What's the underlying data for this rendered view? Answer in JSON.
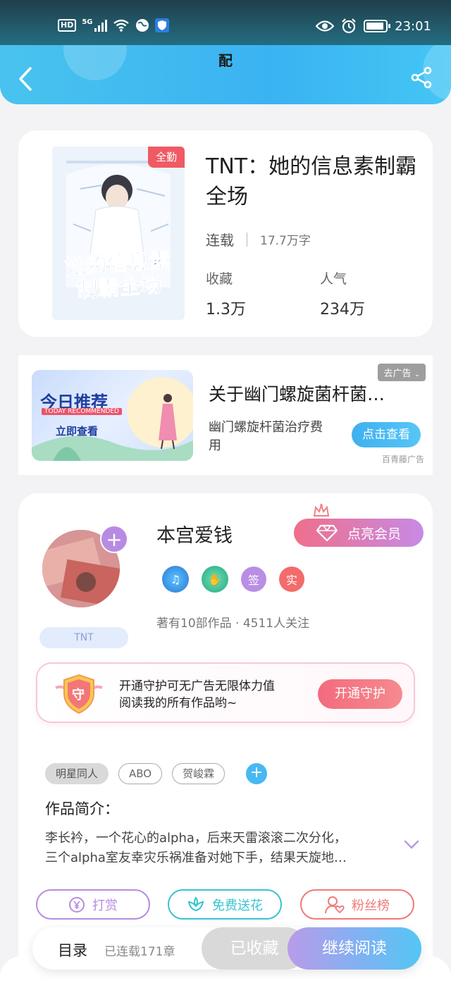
{
  "status_bar": {
    "hd": "HD",
    "network": "5G",
    "time": "23:01"
  },
  "header": {
    "title": "配"
  },
  "book": {
    "cover_badge": "全勤",
    "cover_title_text": "她的信息素 制霸全场",
    "title": "TNT：她的信息素制霸全场",
    "status": "连载",
    "words": "17.7万字",
    "favorites_label": "收藏",
    "favorites_value": "1.3万",
    "popularity_label": "人气",
    "popularity_value": "234万"
  },
  "ad": {
    "image_title": "今日推荐",
    "image_subtitle": "TODAY RECOMMENDED",
    "image_cta": "立即查看",
    "hide_label": "去广告",
    "title": "关于幽门螺旋菌杆菌…",
    "description": "幽门螺旋杆菌治疗费用",
    "button": "点击查看",
    "source": "百青藤广告"
  },
  "author": {
    "name": "本宫爱钱",
    "vip_button": "点亮会员",
    "tag": "TNT",
    "badge_sign": "签",
    "badge_real": "实",
    "meta": "著有10部作品 · 4511人关注",
    "guard_icon_text": "守",
    "guard_text_line1": "开通守护可无广告无限体力值",
    "guard_text_line2": "阅读我的所有作品哟~",
    "guard_button": "开通守护"
  },
  "tags": [
    "明星同人",
    "ABO",
    "贺峻霖"
  ],
  "intro": {
    "title": "作品简介：",
    "line1": "李长衿，一个花心的alpha，后来天雷滚滚二次分化，",
    "line2": "三个alpha室友幸灾乐祸准备对她下手，结果天旋地…"
  },
  "actions": {
    "reward": "打赏",
    "flower": "免费送花",
    "fans": "粉丝榜"
  },
  "bottom_bar": {
    "toc": "目录",
    "chapters": "已连载171章",
    "favorited": "已收藏",
    "continue": "继续阅读"
  },
  "colors": {
    "header_blue": "#3ab3f2",
    "cover_badge_red": "#ef5a64",
    "vip_gradient_start": "#ef6f8b",
    "vip_gradient_end": "#c78ae5",
    "reward_purple": "#b88be3",
    "flower_teal": "#38c4d0",
    "fans_red": "#ef7a7a"
  }
}
